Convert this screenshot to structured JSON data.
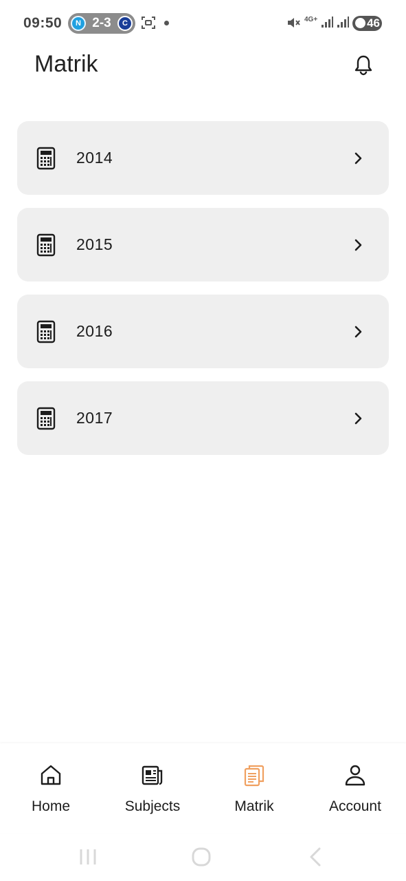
{
  "status_bar": {
    "time": "09:50",
    "score": "2-3",
    "team_a_initial": "N",
    "team_b_initial": "C",
    "network": "4G+",
    "battery": "46"
  },
  "header": {
    "title": "Matrik",
    "notification_icon": "bell-icon"
  },
  "years": [
    {
      "label": "2014",
      "icon": "calculator-icon"
    },
    {
      "label": "2015",
      "icon": "calculator-icon"
    },
    {
      "label": "2016",
      "icon": "calculator-icon"
    },
    {
      "label": "2017",
      "icon": "calculator-icon"
    }
  ],
  "bottom_nav": {
    "items": [
      {
        "label": "Home",
        "icon": "home-icon"
      },
      {
        "label": "Subjects",
        "icon": "newspaper-icon"
      },
      {
        "label": "Matrik",
        "icon": "clipboard-icon",
        "active": true
      },
      {
        "label": "Account",
        "icon": "user-icon"
      }
    ]
  },
  "colors": {
    "accent": "#f0a060",
    "card_bg": "#efefef",
    "text": "#1c1c1c"
  }
}
